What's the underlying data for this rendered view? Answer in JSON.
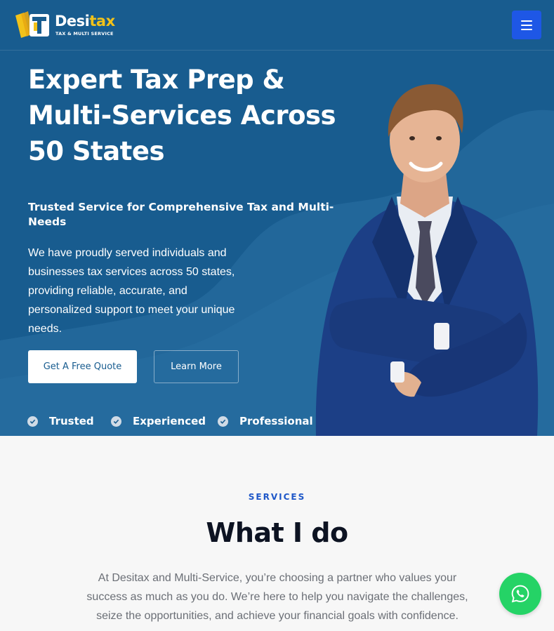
{
  "brand": {
    "name_main": "Desi",
    "name_accent": "tax",
    "tagline": "TAX & MULTI SERVICE"
  },
  "header": {
    "menu_icon": "hamburger-menu-icon"
  },
  "hero": {
    "title": "Expert Tax Prep & Multi-Services Across 50 States",
    "subtitle": "Trusted Service for Comprehensive Tax and Multi-Needs",
    "description": "We have proudly served individuals and businesses tax services across 50 states, providing reliable, accurate, and personalized support to meet your unique needs.",
    "primary_button": "Get A Free Quote",
    "secondary_button": "Learn More",
    "badges": [
      {
        "label": "Trusted",
        "icon": "check-circle-icon"
      },
      {
        "label": "Experienced",
        "icon": "check-circle-icon"
      },
      {
        "label": "Professional",
        "icon": "check-circle-icon"
      }
    ]
  },
  "services": {
    "kicker": "SERVICES",
    "title": "What I do",
    "description": "At Desitax and Multi-Service, you’re choosing a partner who values your success as much as you do. We’re here to help you navigate the challenges, seize the opportunities, and achieve your financial goals with confidence."
  },
  "floating": {
    "whatsapp_icon": "whatsapp-icon"
  },
  "colors": {
    "hero_bg": "#185c8f",
    "menu_button": "#1e57e6",
    "accent_text": "#1e57c8",
    "whatsapp": "#25d366",
    "logo_accent": "#f2c21a"
  }
}
